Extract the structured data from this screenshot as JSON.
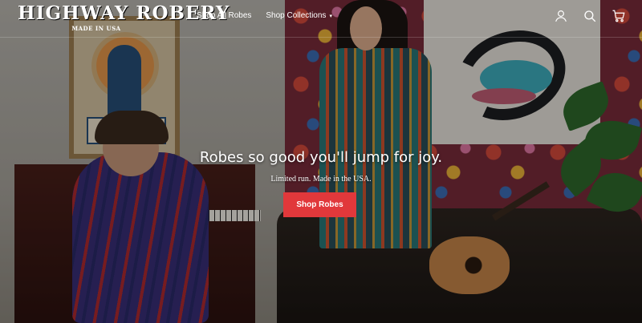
{
  "brand": {
    "name": "HIGHWAY ROBERY",
    "subtitle": "MADE IN USA"
  },
  "nav": {
    "items": [
      {
        "label": "Shop All Robes",
        "has_dropdown": false
      },
      {
        "label": "Shop Collections",
        "has_dropdown": true
      }
    ],
    "dropdown_icon": "chevron-down-icon"
  },
  "header_icons": [
    {
      "name": "account-icon"
    },
    {
      "name": "search-icon"
    },
    {
      "name": "cart-icon"
    }
  ],
  "hero": {
    "headline": "Robes so good you'll jump for joy.",
    "tagline": "Limited run. Made in the USA.",
    "cta_label": "Shop Robes"
  },
  "colors": {
    "accent": "#e1383b",
    "text": "#ffffff"
  }
}
